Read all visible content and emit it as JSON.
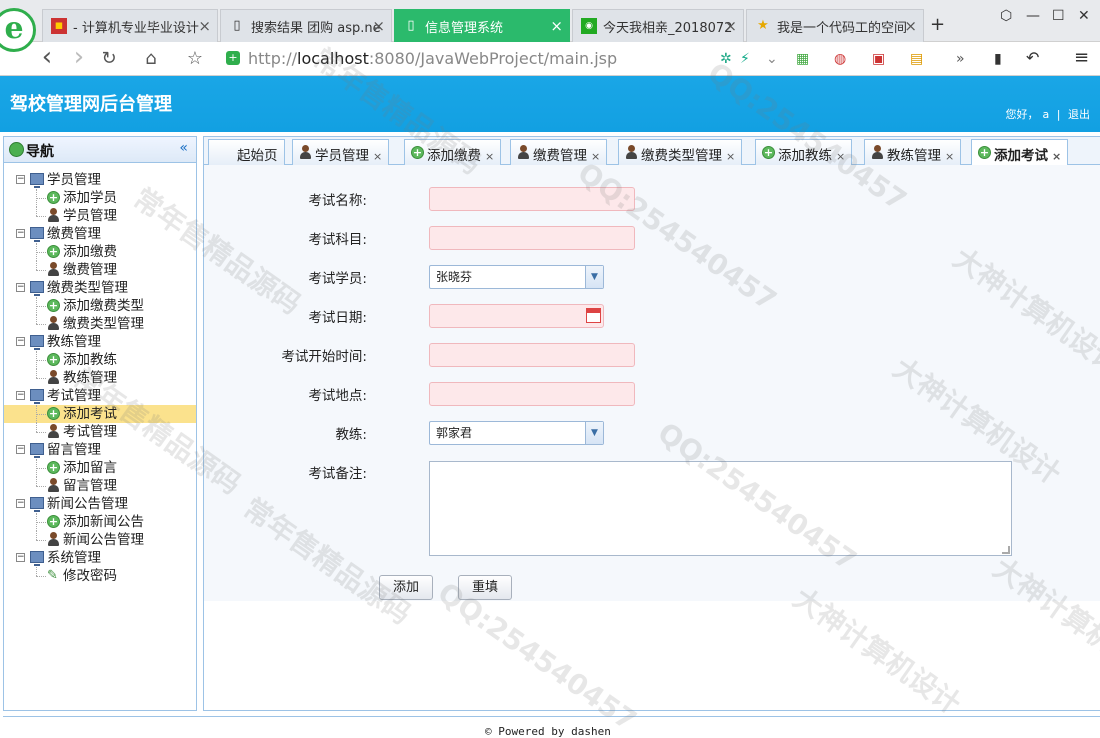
{
  "browser": {
    "tabs": [
      {
        "title": "- 计算机专业毕业设计",
        "icon": "red-block-icon",
        "close": "×"
      },
      {
        "title": "搜索结果 团购 asp.ne",
        "icon": "page-icon",
        "close": "×"
      },
      {
        "title": "信息管理系统",
        "icon": "page-icon",
        "close": "×"
      },
      {
        "title": "今天我相亲_2018072",
        "icon": "green-chat-icon",
        "close": "×"
      },
      {
        "title": "我是一个代码工的空间",
        "icon": "star-icon",
        "close": "×"
      }
    ],
    "new_tab": "+",
    "url_host": "http://",
    "url_bold": "localhost",
    "url_rest": ":8080/JavaWebProject/main.jsp",
    "win_controls": [
      "⬡",
      "—",
      "☐",
      "✕"
    ],
    "nav": {
      "back": "‹",
      "forward": "›",
      "reload": "↻",
      "home": "⌂",
      "favorite": "☆"
    },
    "menu": "≡"
  },
  "header": {
    "title": "驾校管理网后台管理",
    "greeting": "您好，",
    "username": "a",
    "sep": "|",
    "logout": "退出",
    "bg_color": "#17a3e4"
  },
  "sidebar": {
    "title": "导航",
    "collapse": "«",
    "groups": [
      {
        "label": "学员管理",
        "items": [
          {
            "label": "添加学员",
            "icon": "add"
          },
          {
            "label": "学员管理",
            "icon": "user"
          }
        ]
      },
      {
        "label": "缴费管理",
        "items": [
          {
            "label": "添加缴费",
            "icon": "add"
          },
          {
            "label": "缴费管理",
            "icon": "user"
          }
        ]
      },
      {
        "label": "缴费类型管理",
        "items": [
          {
            "label": "添加缴费类型",
            "icon": "add"
          },
          {
            "label": "缴费类型管理",
            "icon": "user"
          }
        ]
      },
      {
        "label": "教练管理",
        "items": [
          {
            "label": "添加教练",
            "icon": "add"
          },
          {
            "label": "教练管理",
            "icon": "user"
          }
        ]
      },
      {
        "label": "考试管理",
        "items": [
          {
            "label": "添加考试",
            "icon": "add",
            "selected": true
          },
          {
            "label": "考试管理",
            "icon": "user"
          }
        ]
      },
      {
        "label": "留言管理",
        "items": [
          {
            "label": "添加留言",
            "icon": "add"
          },
          {
            "label": "留言管理",
            "icon": "user"
          }
        ]
      },
      {
        "label": "新闻公告管理",
        "items": [
          {
            "label": "添加新闻公告",
            "icon": "add"
          },
          {
            "label": "新闻公告管理",
            "icon": "user"
          }
        ]
      },
      {
        "label": "系统管理",
        "items": [
          {
            "label": "修改密码",
            "icon": "pen"
          }
        ]
      }
    ]
  },
  "page_tabs": [
    {
      "label": "起始页",
      "icon": "none",
      "closable": false
    },
    {
      "label": "学员管理",
      "icon": "user",
      "closable": true
    },
    {
      "label": "添加缴费",
      "icon": "add",
      "closable": true
    },
    {
      "label": "缴费管理",
      "icon": "user",
      "closable": true
    },
    {
      "label": "缴费类型管理",
      "icon": "user",
      "closable": true
    },
    {
      "label": "添加教练",
      "icon": "add",
      "closable": true
    },
    {
      "label": "教练管理",
      "icon": "user",
      "closable": true
    },
    {
      "label": "添加考试",
      "icon": "add",
      "closable": true,
      "active": true
    }
  ],
  "tab_close": "×",
  "form": {
    "exam_name_label": "考试名称:",
    "exam_name_value": "",
    "subject_label": "考试科目:",
    "subject_value": "",
    "student_label": "考试学员:",
    "student_value": "张晓芬",
    "date_label": "考试日期:",
    "date_value": "",
    "start_time_label": "考试开始时间:",
    "start_time_value": "",
    "place_label": "考试地点:",
    "place_value": "",
    "coach_label": "教练:",
    "coach_value": "郭家君",
    "remark_label": "考试备注:",
    "remark_value": "",
    "submit": "添加",
    "reset": "重填",
    "dropdown_arrow": "▼"
  },
  "footer": {
    "text": "© Powered by dashen"
  },
  "watermark": {
    "texts": [
      "常年售精品源码",
      "QQ:254540457",
      "大神计算机设计"
    ]
  }
}
